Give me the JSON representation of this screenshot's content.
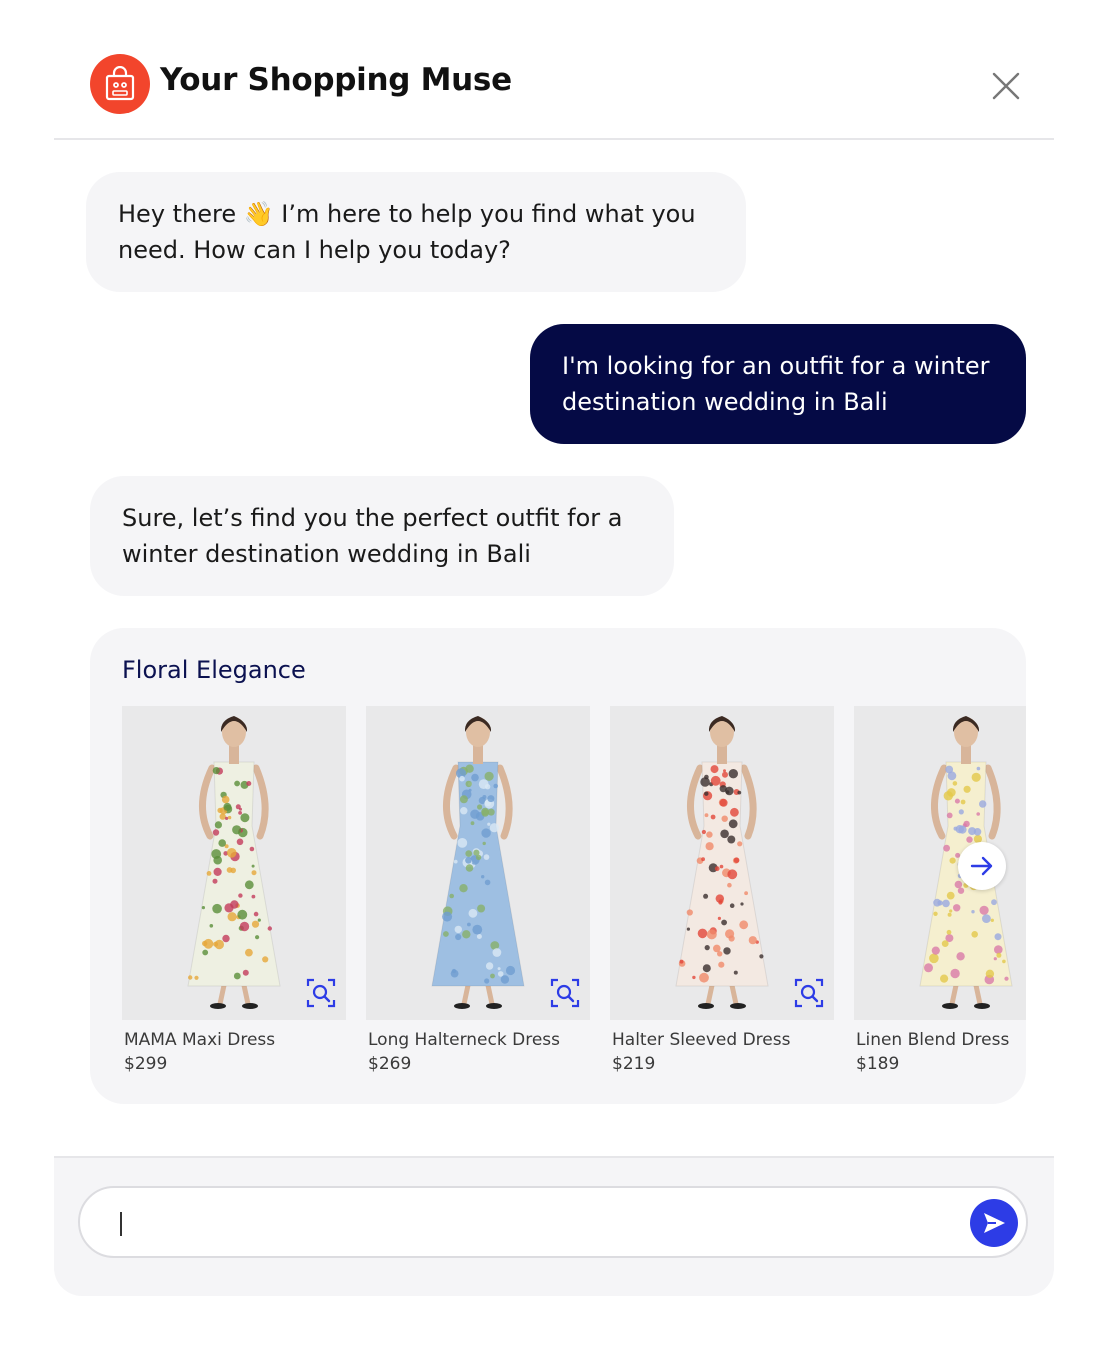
{
  "header": {
    "title": "Your Shopping Muse",
    "logo_icon": "shopping-bag-robot-icon",
    "close_icon": "close-icon"
  },
  "messages": [
    {
      "role": "assistant",
      "text": "Hey there 👋 I’m here to help you find what you need. How can I help you today?"
    },
    {
      "role": "user",
      "text": "I'm looking for an outfit for a winter destination wedding in Bali"
    },
    {
      "role": "assistant",
      "text": "Sure, let’s find you the perfect outfit for a winter destination wedding in Bali"
    }
  ],
  "carousel": {
    "title": "Floral Elegance",
    "products": [
      {
        "name": "MAMA Maxi Dress",
        "price": "$299",
        "dress_color": "#eef0e2",
        "print": [
          "#5a8f3a",
          "#c33b5b",
          "#e6a83a"
        ]
      },
      {
        "name": "Long Halterneck Dress",
        "price": "$269",
        "dress_color": "#9ebfe2",
        "print": [
          "#6f9ed1",
          "#d9e8f5",
          "#87b06a"
        ]
      },
      {
        "name": "Halter Sleeved Dress",
        "price": "$219",
        "dress_color": "#f3e9e2",
        "print": [
          "#e2463a",
          "#f08a6a",
          "#3a2e2e"
        ]
      },
      {
        "name": "Linen Blend Dress",
        "price": "$189",
        "dress_color": "#f5efcf",
        "print": [
          "#e3c84a",
          "#9aa9e0",
          "#d97aa8"
        ]
      }
    ],
    "zoom_icon": "visual-search-icon",
    "next_icon": "arrow-right-icon"
  },
  "composer": {
    "placeholder": "",
    "value": "",
    "send_icon": "send-icon"
  },
  "colors": {
    "brand": "#f2452c",
    "user_bubble": "#050a45",
    "accent": "#2d3ce6"
  }
}
